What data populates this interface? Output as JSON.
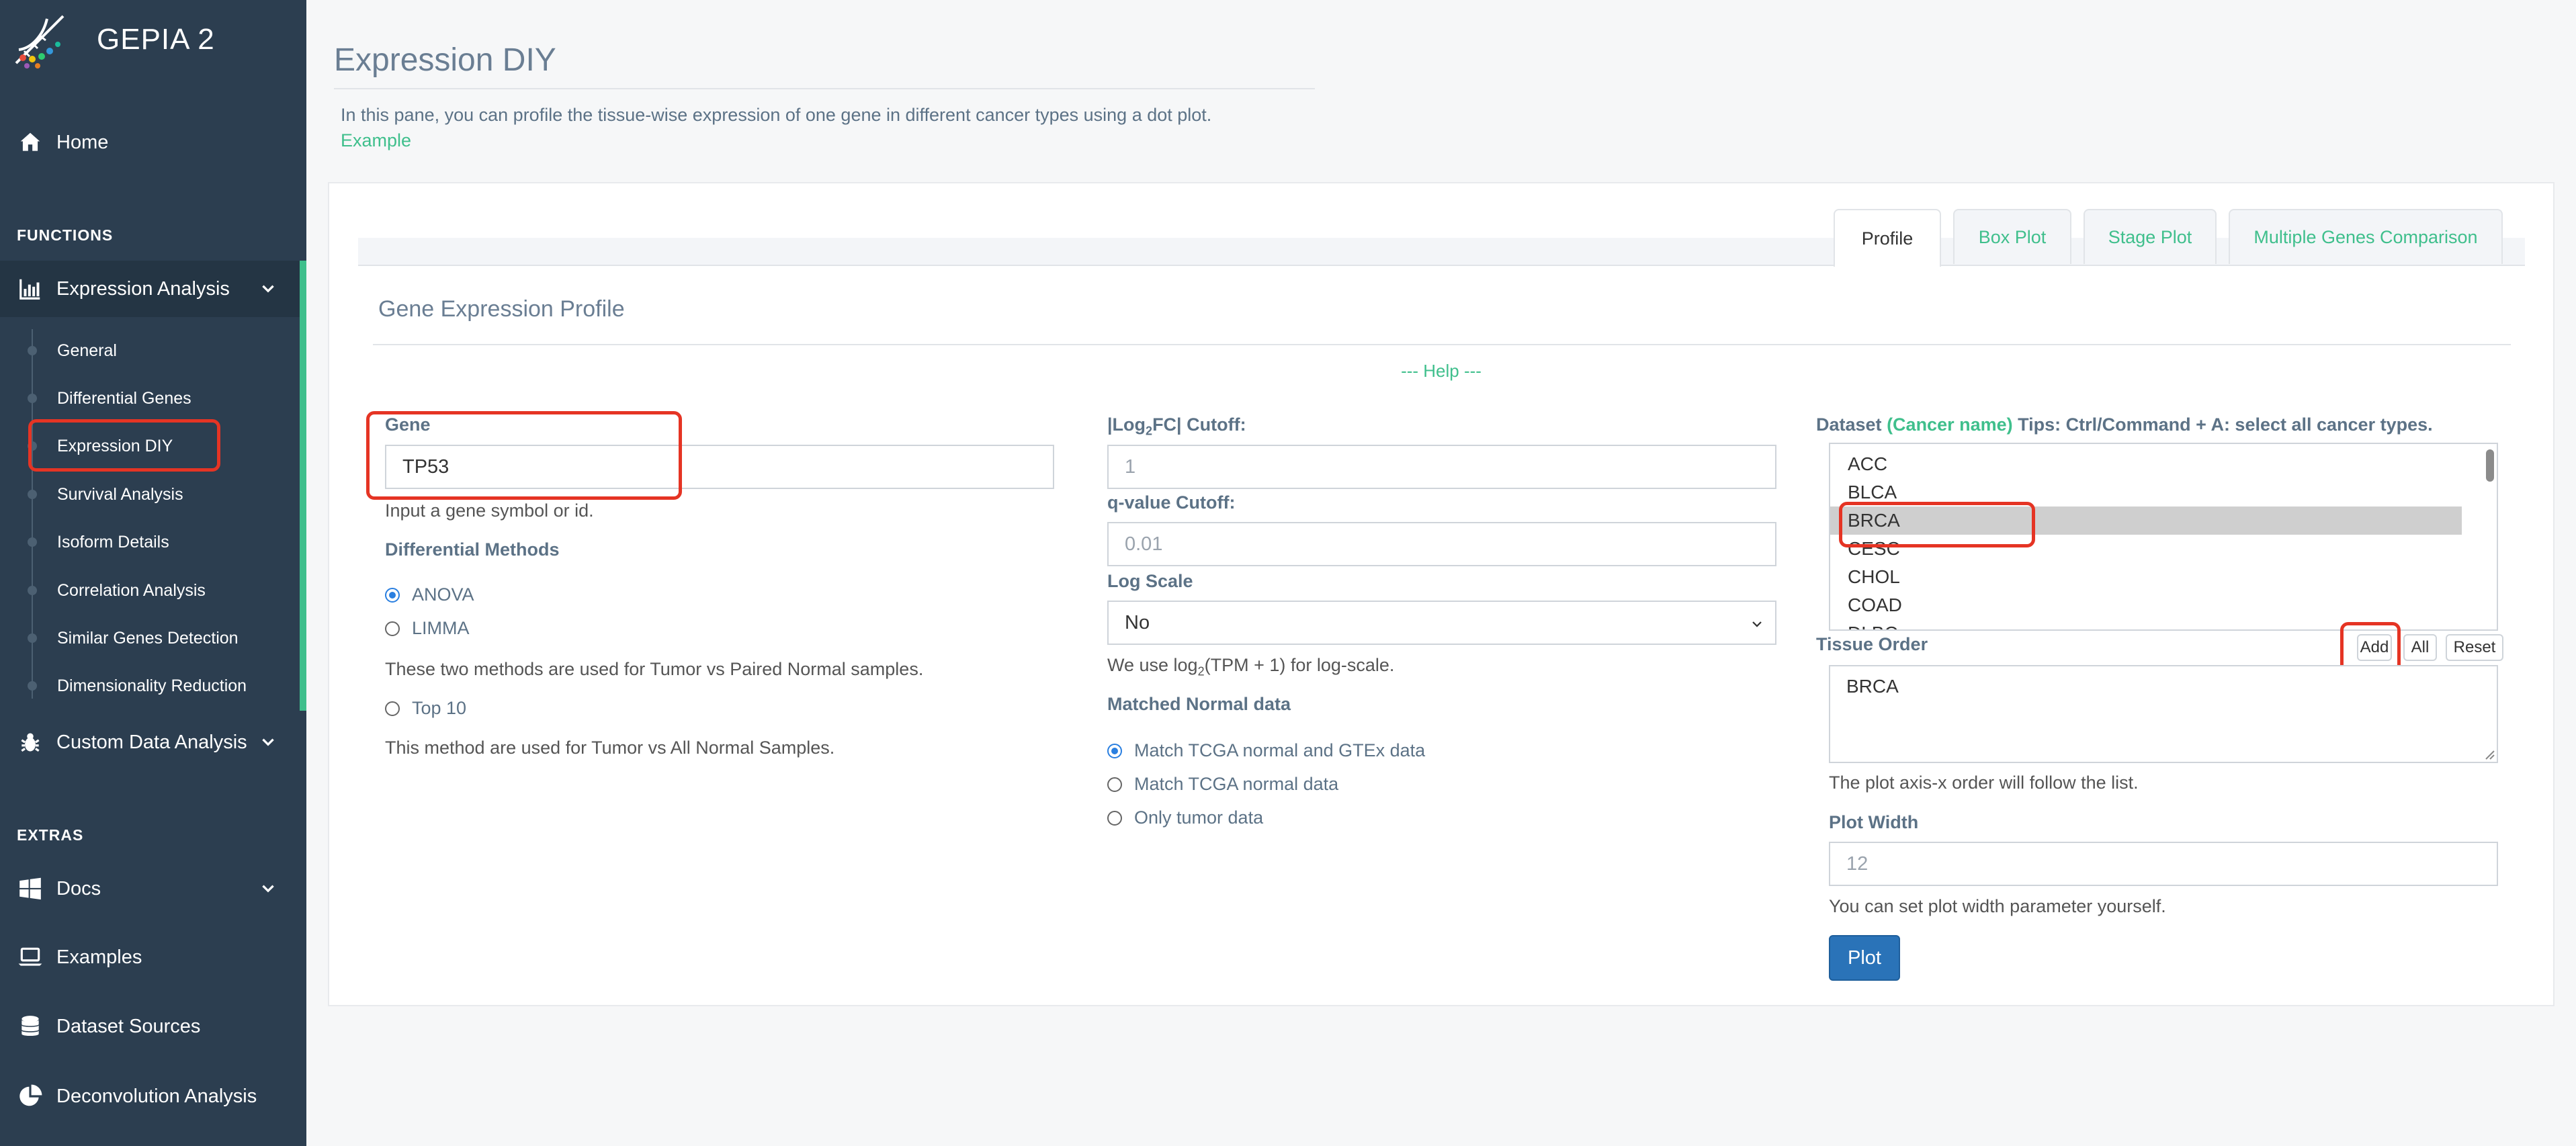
{
  "sidebar": {
    "brand": "GEPIA 2",
    "home": "Home",
    "functions_title": "FUNCTIONS",
    "expression_analysis": "Expression Analysis",
    "sub_items": [
      "General",
      "Differential Genes",
      "Expression DIY",
      "Survival Analysis",
      "Isoform Details",
      "Correlation Analysis",
      "Similar Genes Detection",
      "Dimensionality Reduction"
    ],
    "custom_data_analysis": "Custom Data Analysis",
    "extras_title": "EXTRAS",
    "docs": "Docs",
    "examples": "Examples",
    "dataset_sources": "Dataset Sources",
    "deconvolution_analysis": "Deconvolution Analysis"
  },
  "header": {
    "title": "Expression DIY",
    "intro": "In this pane, you can profile the tissue-wise expression of one gene in different cancer types using a dot plot.",
    "example_link": "Example"
  },
  "tabs": [
    "Profile",
    "Box Plot",
    "Stage Plot",
    "Multiple Genes Comparison"
  ],
  "form": {
    "section_title": "Gene Expression Profile",
    "help": "--- Help ---",
    "gene_label": "Gene",
    "gene_value": "TP53",
    "gene_hint": "Input a gene symbol or id.",
    "diff_methods_label": "Differential Methods",
    "method_anova": "ANOVA",
    "method_limma": "LIMMA",
    "methods_note": "These two methods are used for Tumor vs Paired Normal samples.",
    "method_top10": "Top 10",
    "top10_note": "This method are used for Tumor vs All Normal Samples.",
    "log2fc_label_pre": "|Log",
    "log2fc_label_sub": "2",
    "log2fc_label_post": "FC| Cutoff:",
    "log2fc_placeholder": "1",
    "qvalue_label": "q-value Cutoff:",
    "qvalue_placeholder": "0.01",
    "logscale_label": "Log Scale",
    "logscale_value": "No",
    "logscale_note_pre": "We use log",
    "logscale_note_sub": "2",
    "logscale_note_post": "(TPM + 1) for log-scale.",
    "matched_normal_label": "Matched Normal data",
    "match_opt1": "Match TCGA normal and GTEx data",
    "match_opt2": "Match TCGA normal data",
    "match_opt3": "Only tumor data",
    "dataset_label": "Dataset",
    "dataset_cancer_name": "(Cancer name)",
    "dataset_tips": "Tips: Ctrl/Command + A: select all cancer types.",
    "dataset_options": [
      "ACC",
      "BLCA",
      "BRCA",
      "CESC",
      "CHOL",
      "COAD",
      "DLBC"
    ],
    "dataset_selected": "BRCA",
    "tissue_order_label": "Tissue Order",
    "btn_add": "Add",
    "btn_all": "All",
    "btn_reset": "Reset",
    "tissue_order_value": "BRCA",
    "tissue_note": "The plot axis-x order will follow the list.",
    "plot_width_label": "Plot Width",
    "plot_width_placeholder": "12",
    "plot_width_note": "You can set plot width parameter yourself.",
    "plot_button": "Plot"
  },
  "colors": {
    "sidebar_bg": "#2c3e50",
    "accent_green": "#3fbf8c",
    "highlight_red": "#e53424",
    "primary_blue": "#2a73b8"
  }
}
